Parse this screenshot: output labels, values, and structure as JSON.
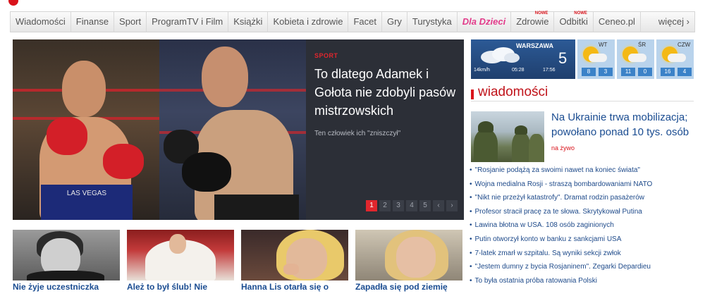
{
  "nav": {
    "items": [
      {
        "label": "Wiadomości",
        "badge": ""
      },
      {
        "label": "Finanse",
        "badge": ""
      },
      {
        "label": "Sport",
        "badge": ""
      },
      {
        "label": "ProgramTV i Film",
        "badge": ""
      },
      {
        "label": "Książki",
        "badge": ""
      },
      {
        "label": "Kobieta i zdrowie",
        "badge": ""
      },
      {
        "label": "Facet",
        "badge": ""
      },
      {
        "label": "Gry",
        "badge": ""
      },
      {
        "label": "Turystyka",
        "badge": ""
      },
      {
        "label": "Dla Dzieci",
        "badge": ""
      },
      {
        "label": "Zdrowie",
        "badge": "NOWE"
      },
      {
        "label": "Odbitki",
        "badge": "NOWE"
      },
      {
        "label": "Ceneo.pl",
        "badge": ""
      }
    ],
    "more_label": "więcej ›"
  },
  "hero": {
    "category": "SPORT",
    "title": "To dlatego Adamek i Gołota nie zdobyli pasów mistrzowskich",
    "subtitle": "Ten człowiek ich \"zniszczył\"",
    "trunks_text": "LAS VEGAS",
    "pager": [
      "1",
      "2",
      "3",
      "4",
      "5"
    ],
    "pager_prev": "‹",
    "pager_next": "›"
  },
  "weather": {
    "city": "WARSZAWA",
    "temp": "5",
    "wind": "14km/h",
    "sunrise": "05:28",
    "sunset": "17:56",
    "days": [
      {
        "name": "WT",
        "t1": "8",
        "t2": "3"
      },
      {
        "name": "ŚR",
        "t1": "11",
        "t2": "0"
      },
      {
        "name": "CZW",
        "t1": "16",
        "t2": "4"
      }
    ]
  },
  "news": {
    "heading": "wiadomości",
    "lead": "Na Ukrainie trwa mobilizacja; powołano ponad 10 tys. osób",
    "lead_live": "na żywo",
    "items": [
      "\"Rosjanie podążą za swoimi nawet na koniec świata\"",
      "Wojna medialna Rosji - straszą bombardowaniami NATO",
      "\"Nikt nie przeżył katastrofy\". Dramat rodzin pasażerów",
      "Profesor stracił pracę za te słowa. Skrytykował Putina",
      "Lawina błotna w USA. 108 osób zaginionych",
      "Putin otworzył konto w banku z sankcjami USA",
      "7-latek zmarł w szpitalu. Są wyniki sekcji zwłok",
      "\"Jestem dumny z bycia Rosjaninem\". Zegarki Depardieu",
      "To była ostatnia próba ratowania Polski"
    ]
  },
  "thumbs": [
    {
      "caption": "Nie żyje uczestniczka"
    },
    {
      "caption": "Ależ to był ślub! Nie"
    },
    {
      "caption": "Hanna Lis otarła się o"
    },
    {
      "caption": "Zapadła się pod ziemię"
    }
  ]
}
